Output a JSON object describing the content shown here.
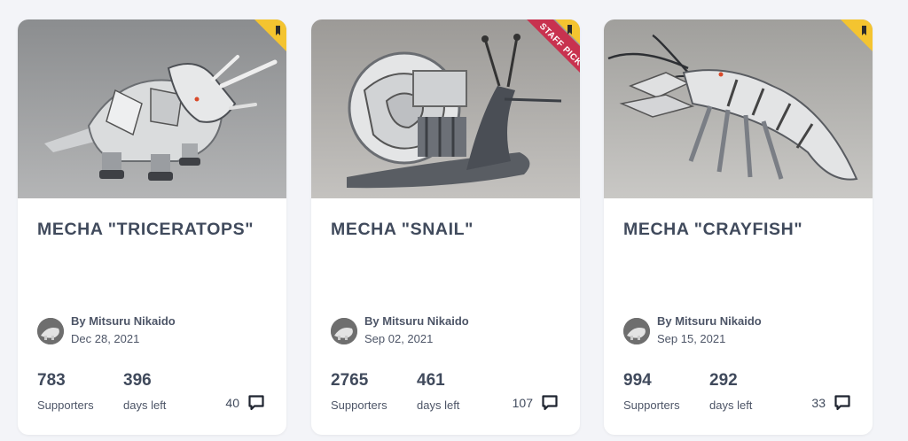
{
  "cards": [
    {
      "title": "MECHA \"TRICERATOPS\"",
      "author": "By Mitsuru Nikaido",
      "date": "Dec 28, 2021",
      "supporters": "783",
      "supporters_label": "Supporters",
      "days_left": "396",
      "days_left_label": "days left",
      "comments": "40",
      "image_icon": "triceratops-model-image",
      "staff_pick": false
    },
    {
      "title": "MECHA \"SNAIL\"",
      "author": "By Mitsuru Nikaido",
      "date": "Sep 02, 2021",
      "supporters": "2765",
      "supporters_label": "Supporters",
      "days_left": "461",
      "days_left_label": "days left",
      "comments": "107",
      "image_icon": "snail-model-image",
      "staff_pick": true,
      "staff_pick_label": "STAFF PICK"
    },
    {
      "title": "MECHA \"CRAYFISH\"",
      "author": "By Mitsuru Nikaido",
      "date": "Sep 15, 2021",
      "supporters": "994",
      "supporters_label": "Supporters",
      "days_left": "292",
      "days_left_label": "days left",
      "comments": "33",
      "image_icon": "crayfish-model-image",
      "staff_pick": false
    }
  ],
  "colors": {
    "background": "#f3f4f8",
    "card": "#ffffff",
    "title_text": "#404a5c",
    "badge_yellow": "#f4c430",
    "staff_pick_red": "#c8324f"
  }
}
